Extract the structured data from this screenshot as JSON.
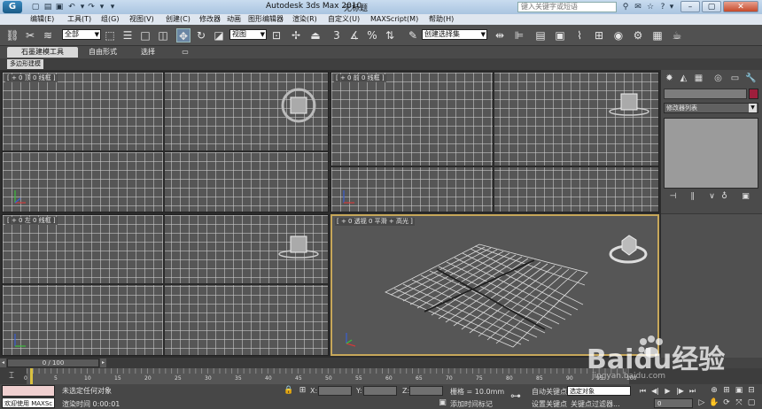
{
  "window": {
    "app_title": "Autodesk 3ds Max  2010",
    "document_title": "无标题",
    "search_placeholder": "键入关键字或短语",
    "logo": "max-logo"
  },
  "menu": {
    "items": [
      "编辑(E)",
      "工具(T)",
      "组(G)",
      "视图(V)",
      "创建(C)",
      "修改器",
      "动画",
      "图形编辑器",
      "渲染(R)",
      "自定义(U)",
      "MAXScript(M)",
      "帮助(H)"
    ]
  },
  "toolbar": {
    "selection_filter": "全部",
    "reference_coord": "视图",
    "named_selection": "创建选择集"
  },
  "ribbon": {
    "tabs": [
      "石墨建模工具",
      "自由形式",
      "选择"
    ],
    "subtab": "多边形建模"
  },
  "viewports": {
    "top_label": "[ + 0 顶 0 线框 ]",
    "front_label": "[ + 0 前 0 线框 ]",
    "left_label": "[ + 0 左 0 线框 ]",
    "perspective_label": "[ + 0 透视 0 平滑 + 高光 ]"
  },
  "command_panel": {
    "modifier_list": "修改器列表",
    "color_swatch": "#9e1e3c"
  },
  "timeline": {
    "frame_range": "0 / 100",
    "ticks": [
      "0",
      "5",
      "10",
      "15",
      "20",
      "25",
      "30",
      "35",
      "40",
      "45",
      "50",
      "55",
      "60",
      "65",
      "70",
      "75",
      "80",
      "85",
      "90",
      "95",
      "100"
    ]
  },
  "status": {
    "welcome": "欢迎使用 MAXSc",
    "selected": "未选定任何对象",
    "prompt": "渲染时间 0:00:01",
    "x_label": "X:",
    "y_label": "Y:",
    "z_label": "Z:",
    "grid": "栅格 = 10.0mm",
    "add_time_tag": "添加时间标记",
    "auto_key": "自动关键点",
    "set_key": "设置关键点",
    "selected_object": "选定对象",
    "key_filters": "关键点过滤器...",
    "current_frame": "0"
  },
  "watermark": {
    "brand": "Baidu经验",
    "url": "jingyan.baidu.com"
  }
}
